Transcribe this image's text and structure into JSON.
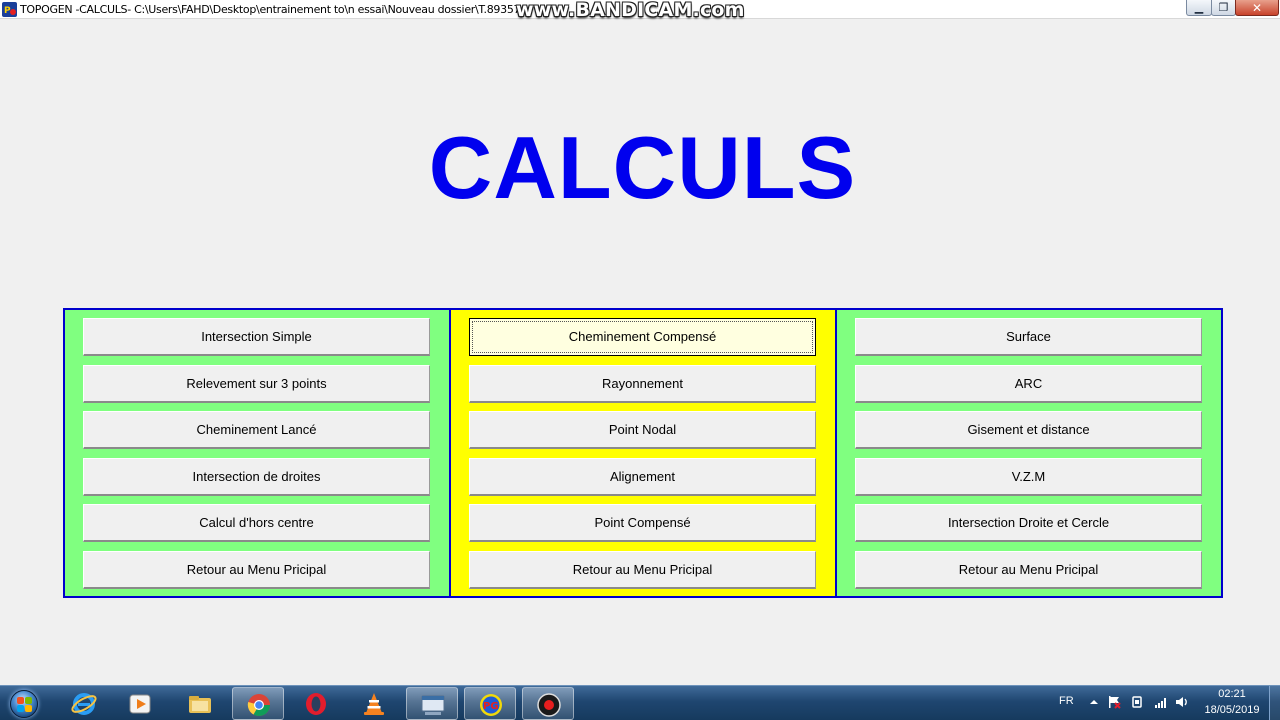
{
  "window": {
    "title": "TOPOGEN -CALCULS- C:\\Users\\FAHD\\Desktop\\entrainement to\\n essai\\Nouveau dossier\\T.89357",
    "watermark": "www.BANDICAM.com",
    "controls": {
      "minimize": "▁",
      "maximize": "❐",
      "close": "✕"
    }
  },
  "heading": "CALCULS",
  "panels": {
    "left": {
      "color": "#80ff80",
      "buttons": [
        "Intersection Simple",
        "Relevement sur 3 points",
        "Cheminement Lancé",
        "Intersection de droites",
        "Calcul d'hors centre",
        "Retour au Menu Pricipal"
      ]
    },
    "middle": {
      "color": "#ffff00",
      "buttons": [
        "Cheminement Compensé",
        "Rayonnement",
        "Point Nodal",
        "Alignement",
        "Point Compensé",
        "Retour au Menu Pricipal"
      ]
    },
    "right": {
      "color": "#80ff80",
      "buttons": [
        "Surface",
        "ARC",
        "Gisement et distance",
        "V.Z.M",
        "Intersection Droite et Cercle",
        "Retour au Menu Pricipal"
      ]
    }
  },
  "colors": {
    "heading": "#0000ee",
    "panel_border": "#0000cc"
  },
  "taskbar": {
    "start_icon": "windows-logo-icon",
    "apps": [
      {
        "name": "internet-explorer-icon"
      },
      {
        "name": "media-player-icon"
      },
      {
        "name": "file-explorer-icon"
      },
      {
        "name": "chrome-icon"
      },
      {
        "name": "opera-icon"
      },
      {
        "name": "vlc-icon"
      },
      {
        "name": "topogen-window-icon"
      },
      {
        "name": "ptg-app-icon"
      },
      {
        "name": "bandicam-record-icon"
      }
    ],
    "tray": {
      "language": "FR",
      "time": "02:21",
      "date": "18/05/2019"
    }
  }
}
